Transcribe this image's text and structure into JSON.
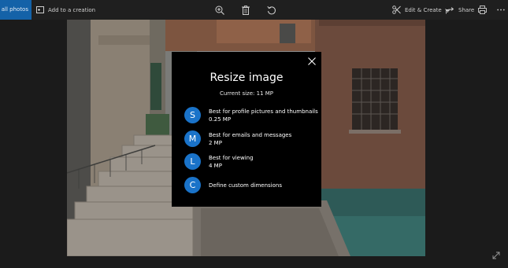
{
  "toolbar": {
    "see_all_label": "See all photos",
    "add_to_creation_label": "Add to a creation",
    "edit_create_label": "Edit & Create",
    "share_label": "Share",
    "icons": [
      "add-to-creation-icon",
      "zoom-in-icon",
      "delete-icon",
      "rotate-icon",
      "edit-create-icon",
      "chevron-down-icon",
      "share-icon",
      "print-icon",
      "more-icon"
    ]
  },
  "dialog": {
    "title": "Resize image",
    "current_size": "Current size: 11 MP",
    "options": [
      {
        "letter": "S",
        "line1": "Best for profile pictures and thumbnails",
        "line2": "0.25 MP"
      },
      {
        "letter": "M",
        "line1": "Best for emails and messages",
        "line2": "2 MP"
      },
      {
        "letter": "L",
        "line1": "Best for viewing",
        "line2": "4 MP"
      },
      {
        "letter": "C",
        "line1": "Define custom dimensions",
        "line2": ""
      }
    ]
  },
  "colors": {
    "accent": "#1a73c9",
    "toolbar_bg": "#1f1f1f",
    "dialog_bg": "#000000",
    "see_all_bg": "#1462a8"
  }
}
